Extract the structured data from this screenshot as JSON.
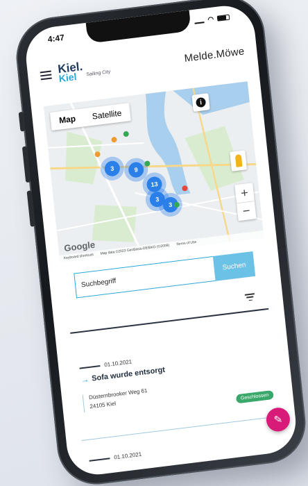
{
  "status": {
    "time": "4:47"
  },
  "header": {
    "logo_text": "Kiel.",
    "logo_alt": "Kiel",
    "logo_sub": "Sailing City",
    "title": "Melde.Möwe"
  },
  "map": {
    "tabs": [
      {
        "label": "Map",
        "active": true
      },
      {
        "label": "Satellite",
        "active": false
      }
    ],
    "info_label": "i",
    "zoom_in": "+",
    "zoom_out": "−",
    "google": "Google",
    "attribution": [
      "Keyboard shortcuts",
      "Map data ©2023 GeoBasis-DE/BKG (©2009)",
      "Terms of Use"
    ],
    "clusters": [
      "3",
      "9",
      "13",
      "3",
      "3"
    ],
    "marker_colors": {
      "orange": "#f29a2e",
      "green": "#34a853",
      "red": "#e8453c"
    }
  },
  "search": {
    "placeholder": "Suchbegriff",
    "button_label": "Suchen"
  },
  "items": [
    {
      "date": "01.10.2021",
      "title": "Sofa wurde entsorgt",
      "address_line1": "Düsternbrooker Weg 61",
      "address_line2": "24105 Kiel",
      "status": "Geschlossen"
    },
    {
      "date": "01.10.2021"
    }
  ],
  "colors": {
    "accent": "#2aa7d8",
    "navy": "#1f3a5f",
    "status_green": "#3aa86a",
    "fab_pink": "#d81b78"
  },
  "fab_icon": "pencil-icon"
}
